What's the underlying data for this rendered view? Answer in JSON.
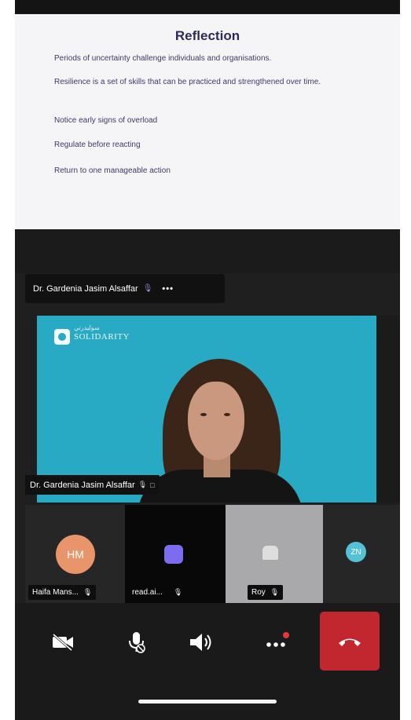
{
  "slide": {
    "title": "Reflection",
    "lines": [
      "Periods of uncertainty challenge individuals and organisations.",
      "Resilience is a set of skills that can be practiced and strengthened over time.",
      "Notice early signs of overload",
      "Regulate before reacting",
      "Return to one manageable action"
    ]
  },
  "speaker_tag": {
    "name": "Dr. Gardenia Jasim Alsaffar",
    "more": "•••"
  },
  "main_video": {
    "name": "Dr. Gardenia Jasim Alsaffar",
    "logo_text": "SOLIDARITY",
    "logo_arabic": "سوليدرتي",
    "background": "#28a9c4"
  },
  "participants": [
    {
      "initials": "HM",
      "label": "Haifa Mans...",
      "avatar_color": "#e8956b"
    },
    {
      "initials": "",
      "label": "read.ai...",
      "avatar_color": "#7c6cf0"
    },
    {
      "initials": "",
      "label": "Roy",
      "avatar_color": "#cfcfcf"
    },
    {
      "initials": "ZN",
      "label": "",
      "avatar_color": "#54c1d6"
    }
  ],
  "controls": {
    "camera": "video-off-icon",
    "mic": "mic-off-icon",
    "speaker": "speaker-icon",
    "more": "more-icon",
    "end": "end-call-icon",
    "end_color": "#c2262f",
    "notify_color": "#e8363a"
  }
}
